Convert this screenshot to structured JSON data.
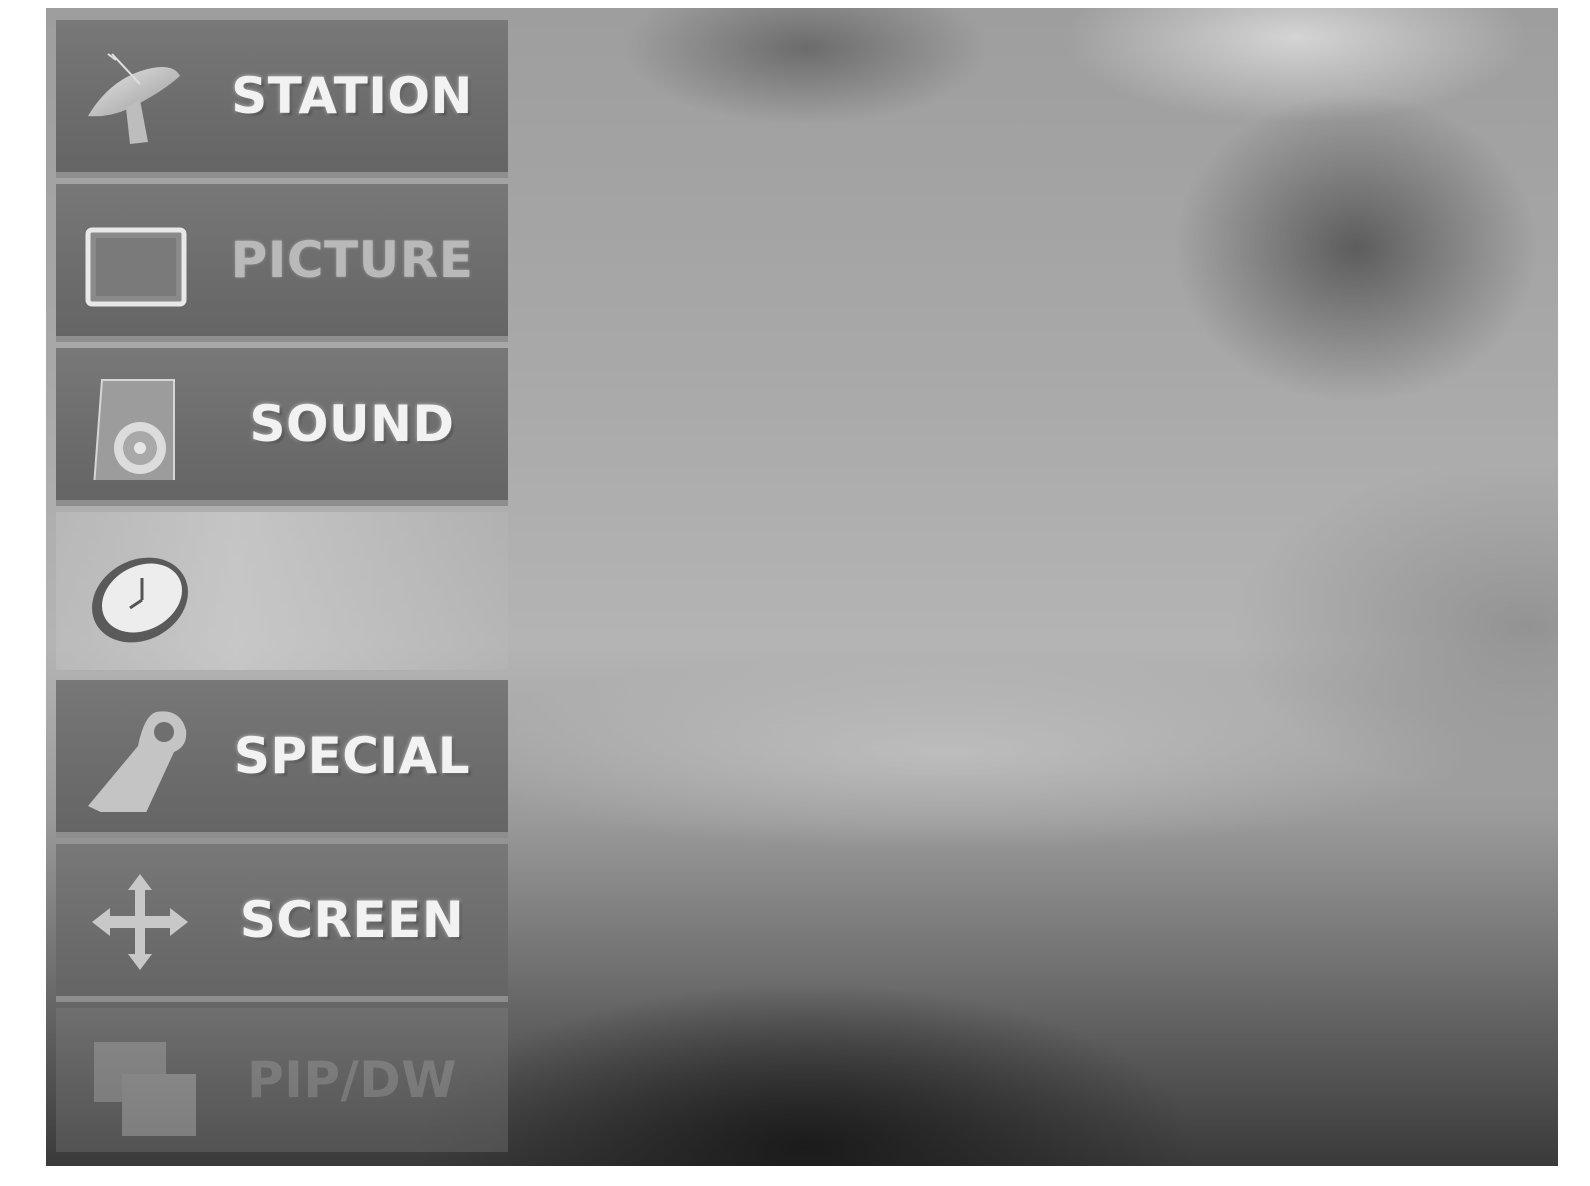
{
  "menu": {
    "items": [
      {
        "label": "STATION",
        "icon": "satellite-dish-icon",
        "state": "normal"
      },
      {
        "label": "PICTURE",
        "icon": "picture-frame-icon",
        "state": "dim"
      },
      {
        "label": "SOUND",
        "icon": "speaker-icon",
        "state": "normal"
      },
      {
        "label": "",
        "icon": "clock-icon",
        "state": "selected"
      },
      {
        "label": "SPECIAL",
        "icon": "tag-icon",
        "state": "normal"
      },
      {
        "label": "SCREEN",
        "icon": "move-arrows-icon",
        "state": "normal"
      },
      {
        "label": "PIP/DW",
        "icon": "pip-windows-icon",
        "state": "disabled"
      }
    ]
  },
  "colors": {
    "menu_item": "#6f6f6f",
    "item_divider": "#8e8e8e",
    "label": "#f2f2f2"
  }
}
